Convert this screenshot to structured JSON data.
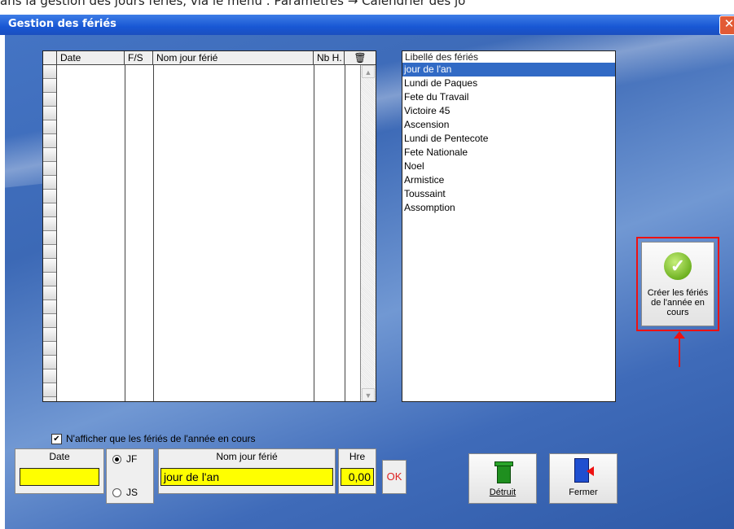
{
  "caption_text": "ans la gestion des jours fériés, via le menu : Paramètres → Calendrier des jo",
  "window": {
    "title": "Gestion des fériés",
    "close_glyph": "✕"
  },
  "grid": {
    "columns": [
      {
        "label": "Date"
      },
      {
        "label": "F/S"
      },
      {
        "label": "Nom jour férié"
      },
      {
        "label": "Nb H."
      }
    ],
    "trash_glyph": "🗑",
    "scroll_up": "▲",
    "scroll_down": "▼",
    "row_count": 24
  },
  "holidays": {
    "header": "Libellé des fériés",
    "items": [
      "jour de l'an",
      "Lundi de Paques",
      "Fete du Travail",
      "Victoire 45",
      "Ascension",
      "Lundi de Pentecote",
      "Fete Nationale",
      "Noel",
      "Armistice",
      "Toussaint",
      "Assomption"
    ],
    "selected_index": 0
  },
  "create_button": {
    "label_1": "Créer les fériés",
    "label_2": "de l'année en",
    "label_3": "cours",
    "icon": "check-icon",
    "glyph": "✓"
  },
  "checkbox": {
    "label": "N'afficher que les fériés de l'année en cours",
    "checked": true,
    "glyph": "✔"
  },
  "form": {
    "date_label": "Date",
    "date_value": "",
    "radio_jf": "JF",
    "radio_js": "JS",
    "radio_selected": "JF",
    "name_label": "Nom jour férié",
    "name_value": "jour de l'an",
    "hre_label": "Hre",
    "hre_value": "0,00",
    "ok_label": "OK"
  },
  "toolbar": {
    "destroy_label": "Détruit",
    "close_label": "Fermer"
  },
  "colors": {
    "accent": "#316ac5",
    "highlight_input": "#ffff00",
    "callout": "#ee1111",
    "title_blue": "#1857d4"
  }
}
